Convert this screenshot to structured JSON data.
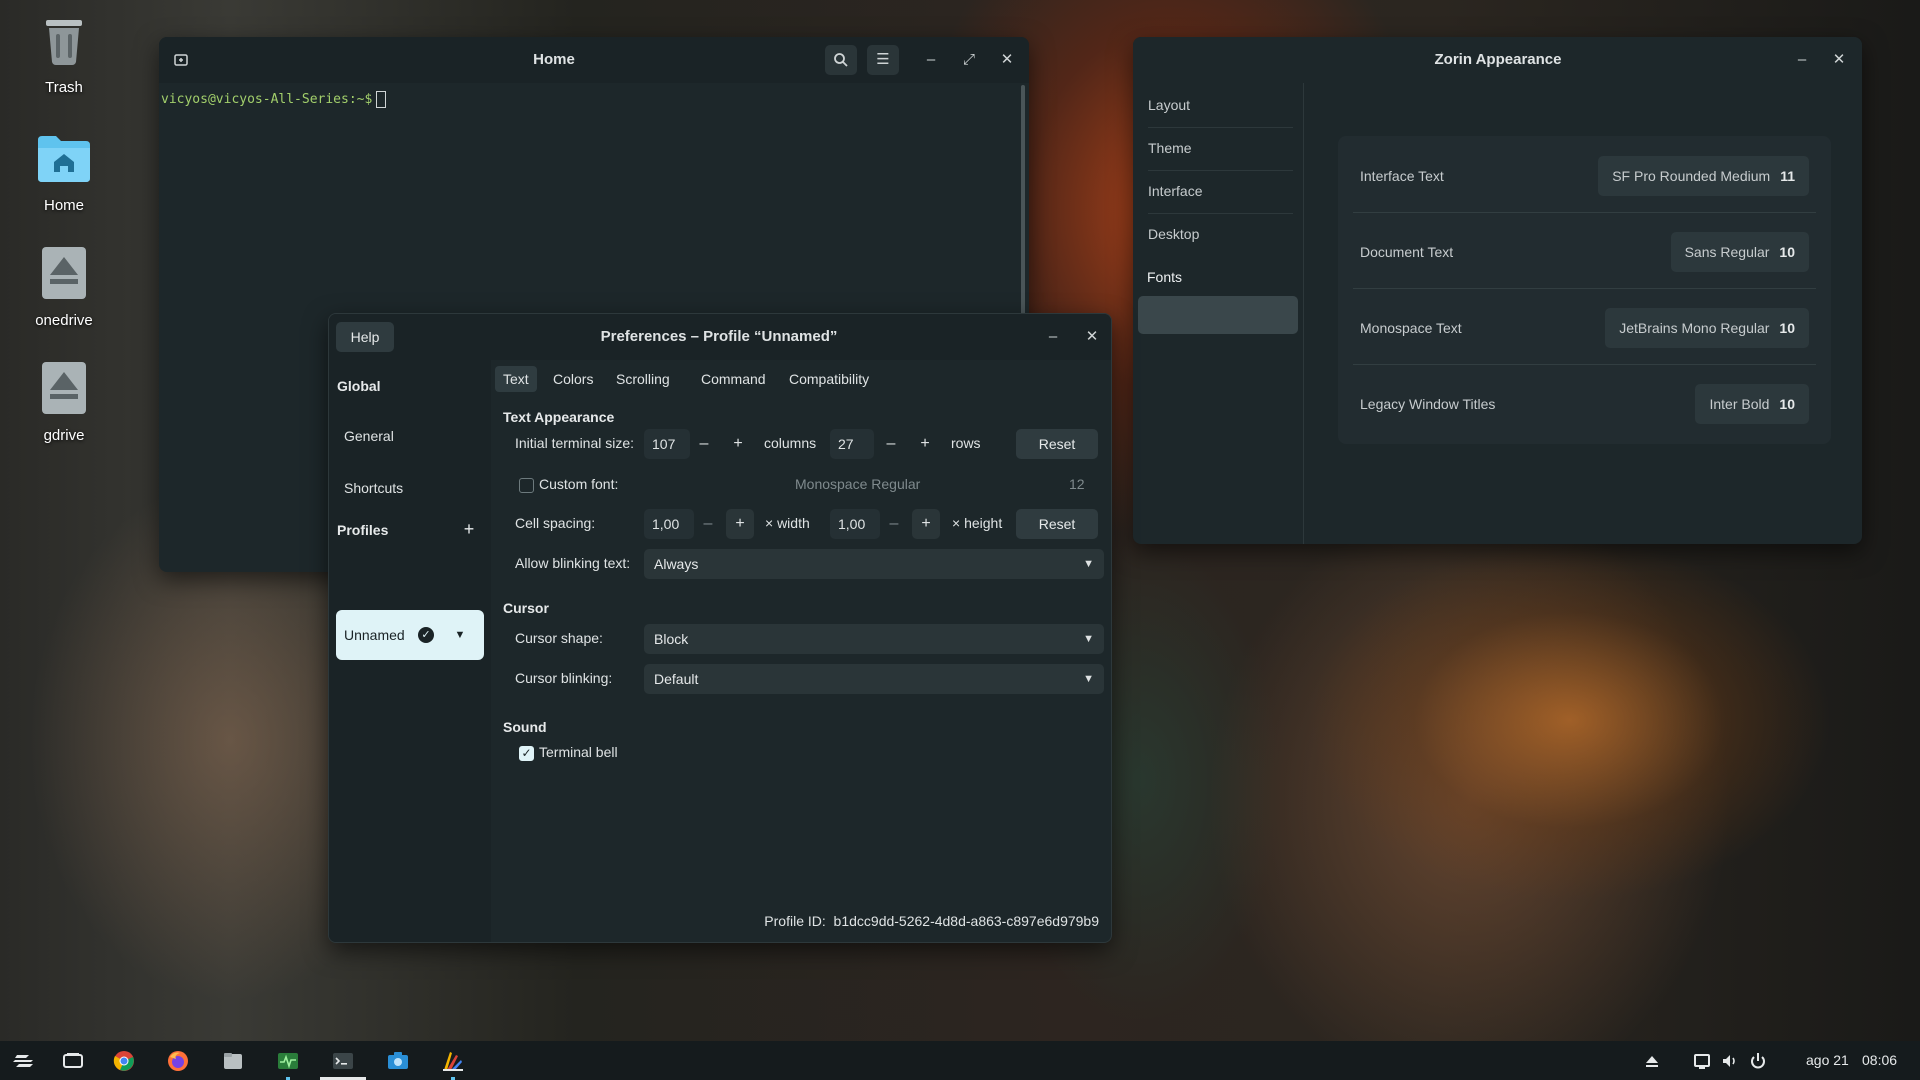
{
  "desktop": {
    "icons": [
      {
        "label": "Trash"
      },
      {
        "label": "Home"
      },
      {
        "label": "onedrive"
      },
      {
        "label": "gdrive"
      }
    ]
  },
  "terminal": {
    "title": "Home",
    "prompt": "vicyos@vicyos-All-Series:~$"
  },
  "prefs": {
    "title": "Preferences – Profile “Unnamed”",
    "help_label": "Help",
    "sidebar": {
      "global_header": "Global",
      "general": "General",
      "shortcuts": "Shortcuts",
      "profiles_header": "Profiles",
      "profile_name": "Unnamed"
    },
    "tabs": [
      "Text",
      "Colors",
      "Scrolling",
      "Command",
      "Compatibility"
    ],
    "text_appearance": {
      "header": "Text Appearance",
      "initial_size_label": "Initial terminal size:",
      "columns_value": "107",
      "columns_unit": "columns",
      "rows_value": "27",
      "rows_unit": "rows",
      "reset_label": "Reset",
      "custom_font_label": "Custom font:",
      "custom_font_name": "Monospace Regular",
      "custom_font_size": "12",
      "cell_spacing_label": "Cell spacing:",
      "width_value": "1,00",
      "width_unit": "× width",
      "height_value": "1,00",
      "height_unit": "× height",
      "blinking_label": "Allow blinking text:",
      "blinking_value": "Always"
    },
    "cursor": {
      "header": "Cursor",
      "shape_label": "Cursor shape:",
      "shape_value": "Block",
      "blinking_label": "Cursor blinking:",
      "blinking_value": "Default"
    },
    "sound": {
      "header": "Sound",
      "bell_label": "Terminal bell"
    },
    "profile_id_label": "Profile ID:",
    "profile_id": "b1dcc9dd-5262-4d8d-a863-c897e6d979b9"
  },
  "appearance": {
    "title": "Zorin Appearance",
    "nav": [
      "Layout",
      "Theme",
      "Interface",
      "Desktop",
      "Fonts"
    ],
    "fonts": [
      {
        "label": "Interface Text",
        "font": "SF Pro Rounded Medium",
        "size": "11"
      },
      {
        "label": "Document Text",
        "font": "Sans Regular",
        "size": "10"
      },
      {
        "label": "Monospace Text",
        "font": "JetBrains Mono Regular",
        "size": "10"
      },
      {
        "label": "Legacy Window Titles",
        "font": "Inter Bold",
        "size": "10"
      }
    ]
  },
  "taskbar": {
    "date": "ago 21",
    "time": "08:06"
  },
  "colors": {
    "accent": "#dff3f7",
    "prompt_green": "#a2cf6b",
    "window_bg": "#1d272a"
  }
}
